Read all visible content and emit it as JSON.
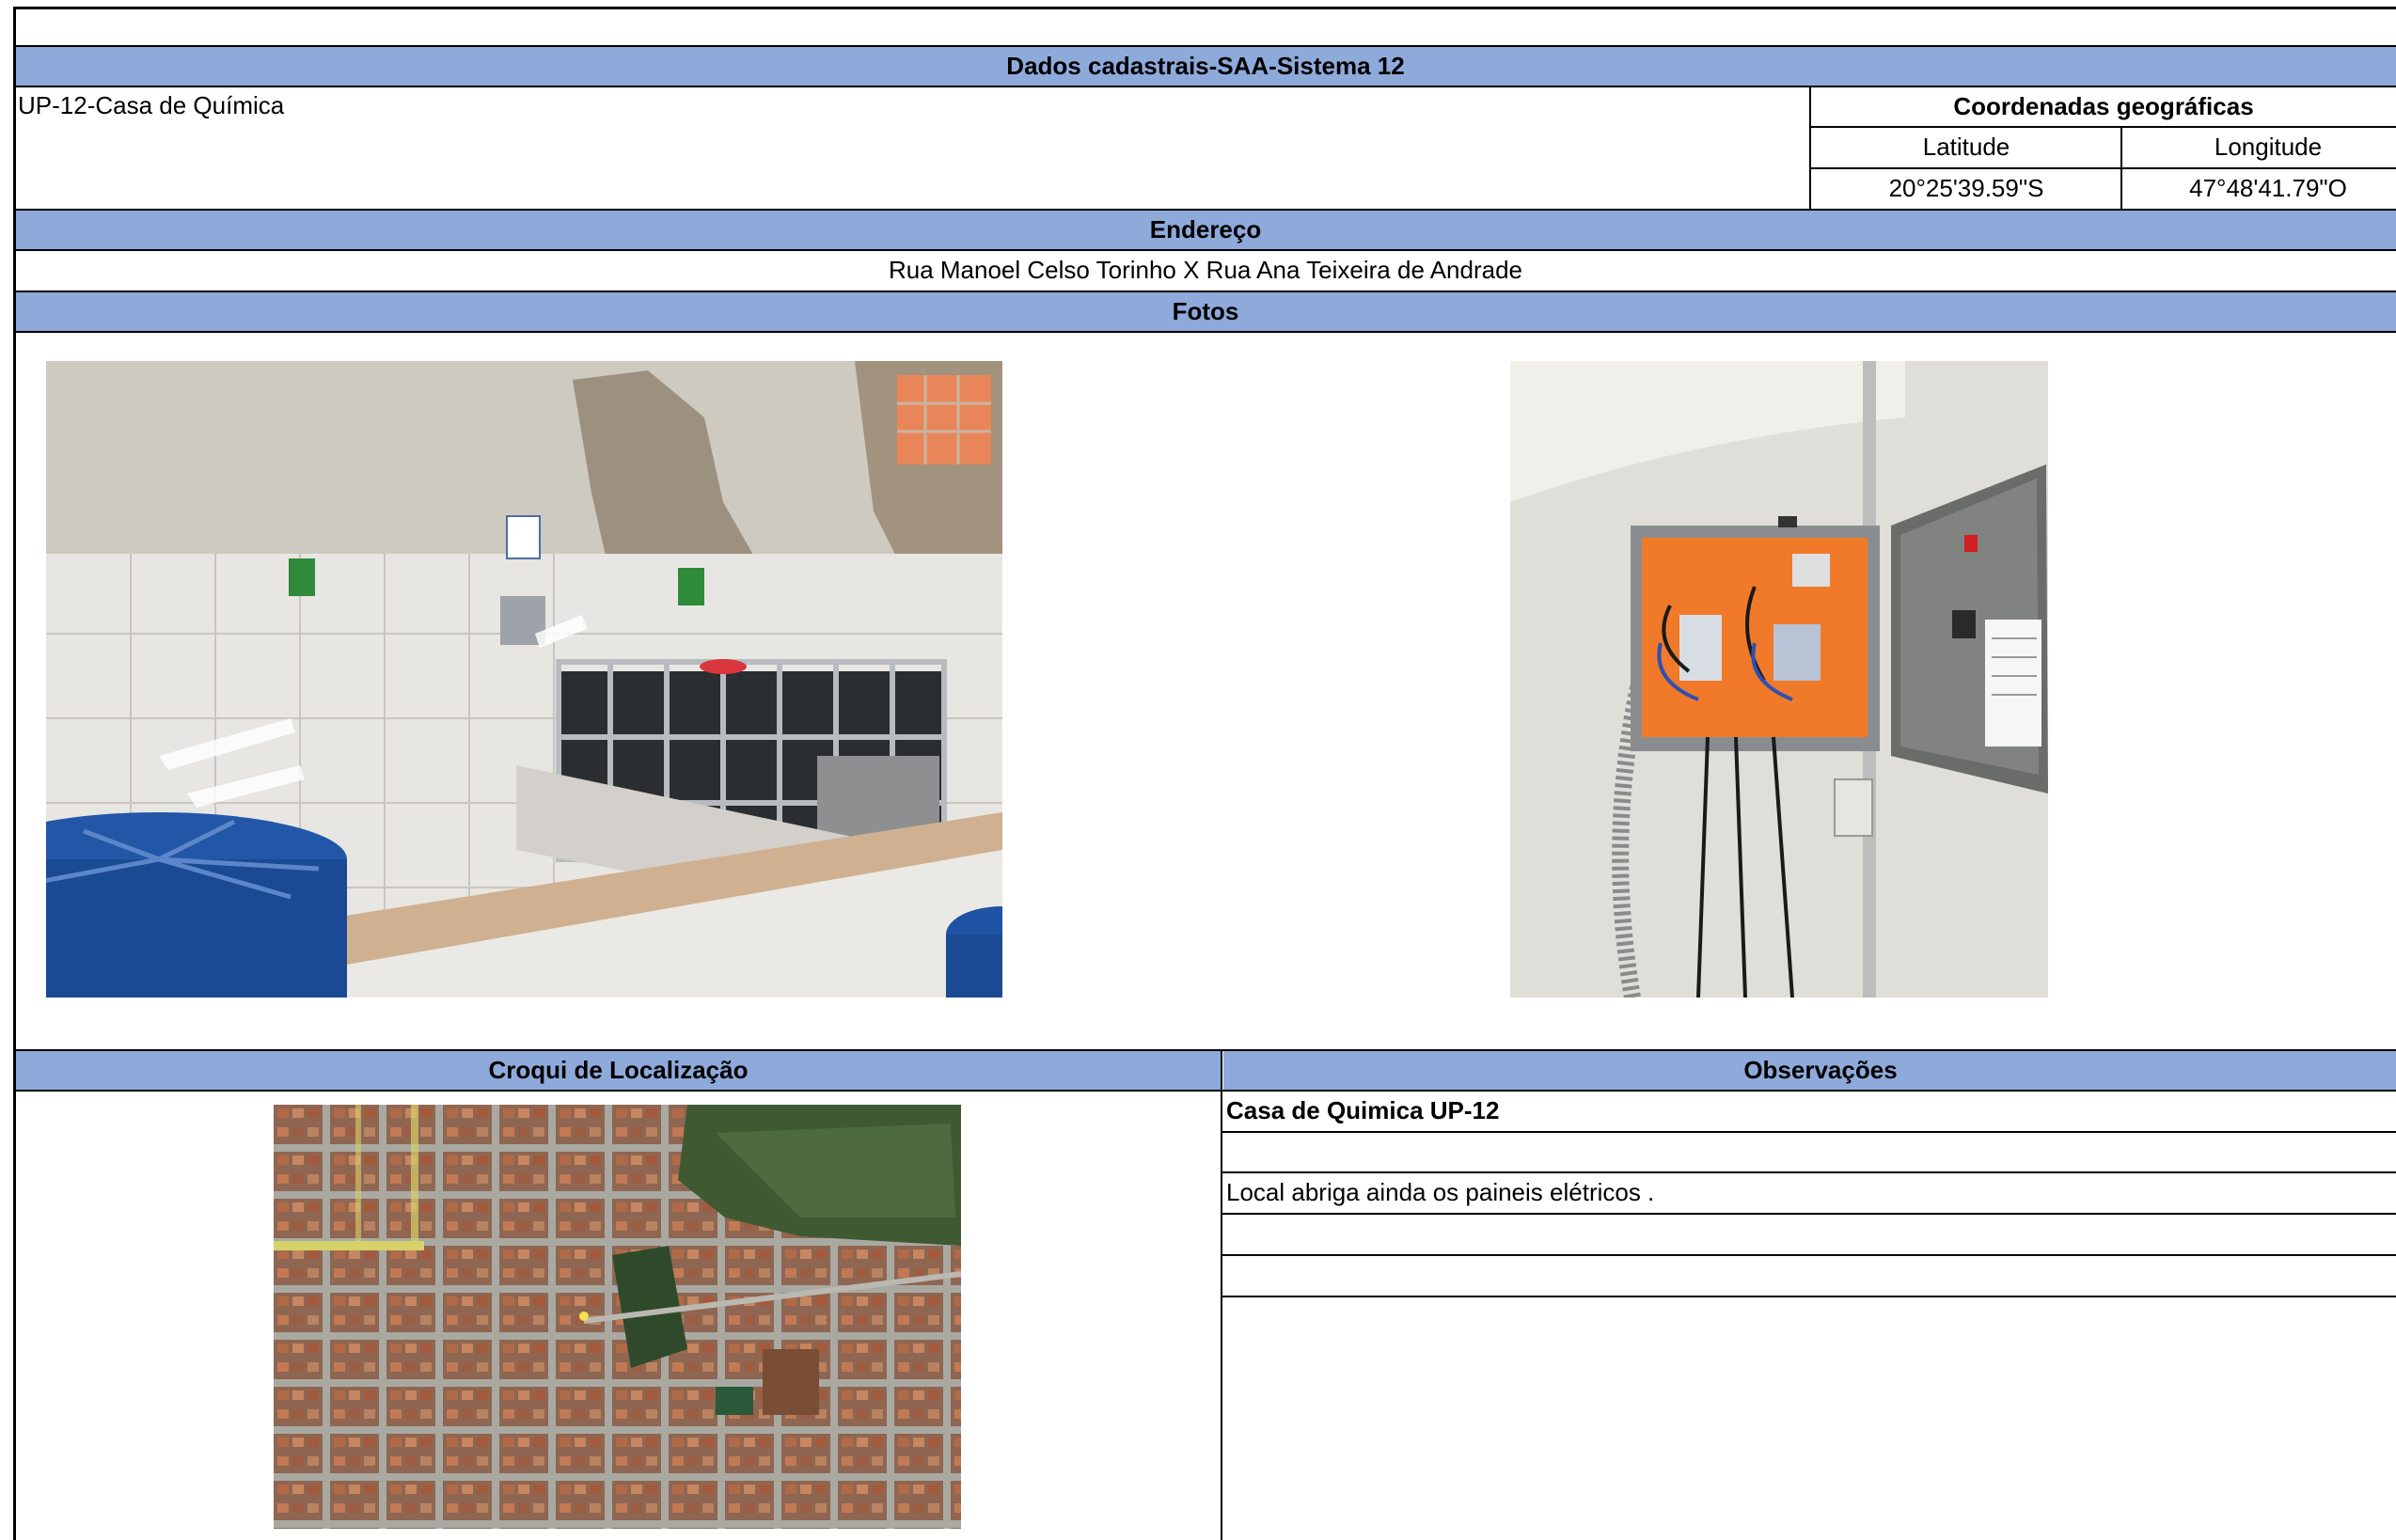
{
  "title": "Dados cadastrais-SAA-Sistema 12",
  "unit_name": "UP-12-Casa de Química",
  "coords": {
    "header": "Coordenadas geográficas",
    "lat_label": "Latitude",
    "lon_label": "Longitude",
    "lat_value": "20°25'39.59\"S",
    "lon_value": "47°48'41.79\"O"
  },
  "address": {
    "header": "Endereço",
    "value": "Rua Manoel Celso Torinho X Rua Ana Teixeira de Andrade"
  },
  "photos": {
    "header": "Fotos"
  },
  "map": {
    "header": "Croqui de Localização"
  },
  "observations": {
    "header": "Observações",
    "lines": [
      "Casa de Quimica UP-12",
      "",
      "Local abriga ainda os paineis elétricos .",
      "",
      ""
    ]
  }
}
